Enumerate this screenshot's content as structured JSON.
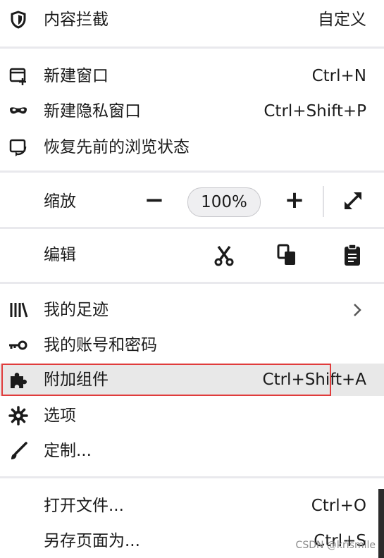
{
  "menu": {
    "tracking": {
      "label": "内容拦截",
      "action": "自定义"
    },
    "new_window": {
      "label": "新建窗口",
      "shortcut": "Ctrl+N"
    },
    "new_private_window": {
      "label": "新建隐私窗口",
      "shortcut": "Ctrl+Shift+P"
    },
    "restore_session": {
      "label": "恢复先前的浏览状态"
    },
    "zoom": {
      "label": "缩放",
      "minus": "−",
      "level": "100%",
      "plus": "+"
    },
    "edit": {
      "label": "编辑"
    },
    "library": {
      "label": "我的足迹"
    },
    "logins": {
      "label": "我的账号和密码"
    },
    "addons": {
      "label": "附加组件",
      "shortcut": "Ctrl+Shift+A"
    },
    "options": {
      "label": "选项"
    },
    "customize": {
      "label": "定制..."
    },
    "open_file": {
      "label": "打开文件...",
      "shortcut": "Ctrl+O"
    },
    "save_page": {
      "label": "另存页面为...",
      "shortcut": "Ctrl+S"
    }
  },
  "watermark": "CSDN @krismile",
  "colors": {
    "separator": "#e9e9ed",
    "highlight": "#e8e8e8",
    "annotation": "#e03c3c"
  }
}
